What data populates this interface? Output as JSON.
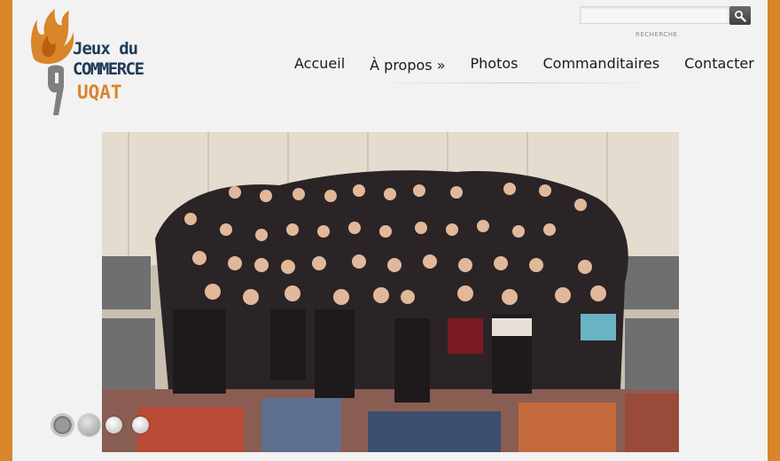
{
  "logo": {
    "line1": "Jeux du",
    "line2": "COMMERCE",
    "line3": "UQAT",
    "colors": {
      "flame": "#d9852a",
      "text": "#1f3b57",
      "mark": "#7f7f7f"
    }
  },
  "search": {
    "placeholder": "",
    "label": "RECHERCHE",
    "button_icon": "magnifier-icon"
  },
  "nav": {
    "items": [
      {
        "label": "Accueil"
      },
      {
        "label": "À propos »"
      },
      {
        "label": "Photos"
      },
      {
        "label": "Commanditaires"
      },
      {
        "label": "Contacter"
      }
    ]
  },
  "slideshow": {
    "dot_count": 4,
    "active_index": 0
  },
  "colors": {
    "frame": "#d9852a",
    "background": "#f2f2f2"
  }
}
